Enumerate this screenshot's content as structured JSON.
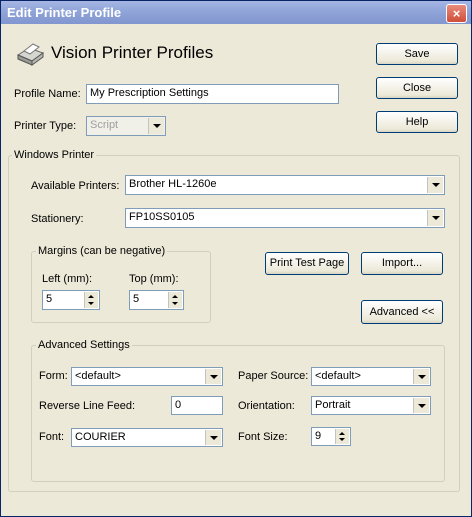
{
  "window": {
    "title": "Edit Printer Profile"
  },
  "header": {
    "title": "Vision Printer Profiles"
  },
  "buttons": {
    "save": "Save",
    "close": "Close",
    "help": "Help",
    "print_test_page": "Print Test Page",
    "import": "Import...",
    "advanced": "Advanced <<"
  },
  "profile": {
    "name_label": "Profile Name:",
    "name_value": "My Prescription Settings",
    "type_label": "Printer Type:",
    "type_value": "Script"
  },
  "windows_printer": {
    "legend": "Windows Printer",
    "available_label": "Available Printers:",
    "available_value": "Brother HL-1260e",
    "stationery_label": "Stationery:",
    "stationery_value": "FP10SS0105",
    "margins": {
      "legend": "Margins (can be negative)",
      "left_label": "Left (mm):",
      "left_value": "5",
      "top_label": "Top (mm):",
      "top_value": "5"
    }
  },
  "advanced_settings": {
    "legend": "Advanced Settings",
    "form_label": "Form:",
    "form_value": "<default>",
    "paper_source_label": "Paper Source:",
    "paper_source_value": "<default>",
    "reverse_label": "Reverse Line Feed:",
    "reverse_value": "0",
    "orientation_label": "Orientation:",
    "orientation_value": "Portrait",
    "font_label": "Font:",
    "font_value": "COURIER",
    "font_size_label": "Font Size:",
    "font_size_value": "9"
  },
  "icons": {
    "close": "close-icon",
    "printer": "printer-icon"
  }
}
